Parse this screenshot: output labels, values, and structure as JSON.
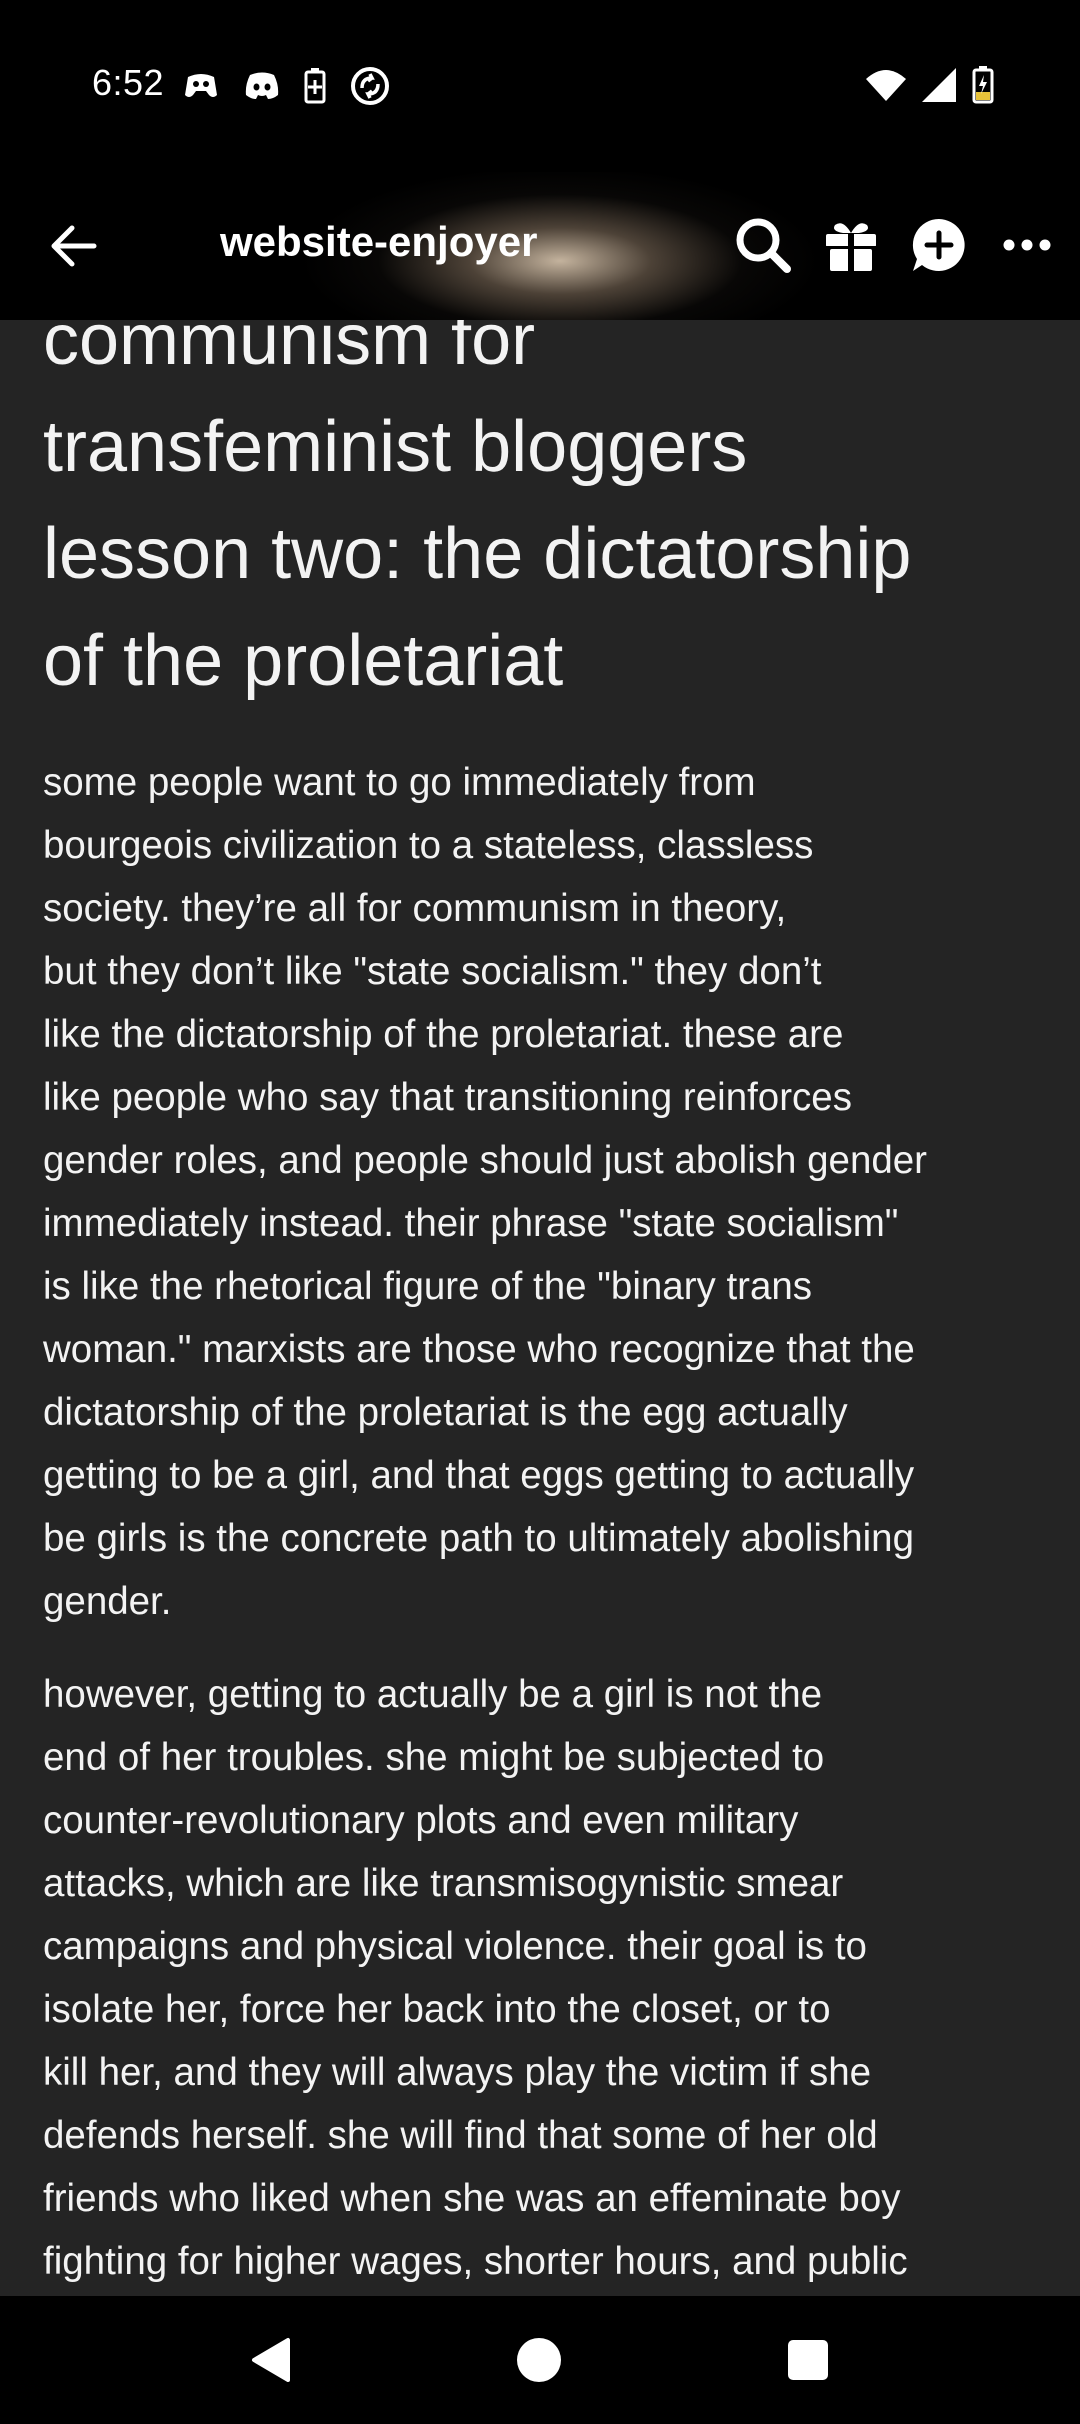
{
  "status_bar": {
    "time": "6:52",
    "left_icons": [
      "discord-controller-icon",
      "discord-icon",
      "battery-saver-icon",
      "sync-app-icon"
    ],
    "right_icons": [
      "wifi-icon",
      "signal-icon",
      "battery-charging-icon"
    ]
  },
  "app_bar": {
    "blog_name": "website-enjoyer",
    "actions": [
      "search-icon",
      "gift-icon",
      "follow-chat-icon",
      "more-icon"
    ]
  },
  "post": {
    "title": "communism for\ntransfeminist bloggers\nlesson two: the dictatorship\nof the proletariat",
    "paragraphs": [
      "some people want to go immediately from\nbourgeois civilization to a stateless, classless\nsociety. they’re all for communism in theory,\nbut they don’t like \"state socialism.\" they don’t\nlike the dictatorship of the proletariat. these are\nlike people who say that transitioning reinforces\ngender roles, and people should just abolish gender\nimmediately instead. their phrase \"state socialism\"\nis like the rhetorical figure of the \"binary trans\nwoman.\" marxists are those who recognize that the\ndictatorship of the proletariat is the egg actually\ngetting to be a girl, and that eggs getting to actually\nbe girls is the concrete path to ultimately abolishing\ngender.",
      "however, getting to actually be a girl is not the\nend of her troubles. she might be subjected to\ncounter-revolutionary plots and even military\nattacks, which are like transmisogynistic smear\ncampaigns and physical violence. their goal is to\nisolate her, force her back into the closet, or to\nkill her, and they will always play the victim if she\ndefends herself. she will find that some of her old\nfriends who liked when she was an effeminate boy\nfighting for higher wages, shorter hours, and public"
    ]
  },
  "nav_bar": {
    "buttons": [
      "back-triangle-icon",
      "home-circle-icon",
      "recents-square-icon"
    ]
  },
  "colors": {
    "background": "#242424",
    "bars": "#000000",
    "text": "#f3f3f3"
  }
}
